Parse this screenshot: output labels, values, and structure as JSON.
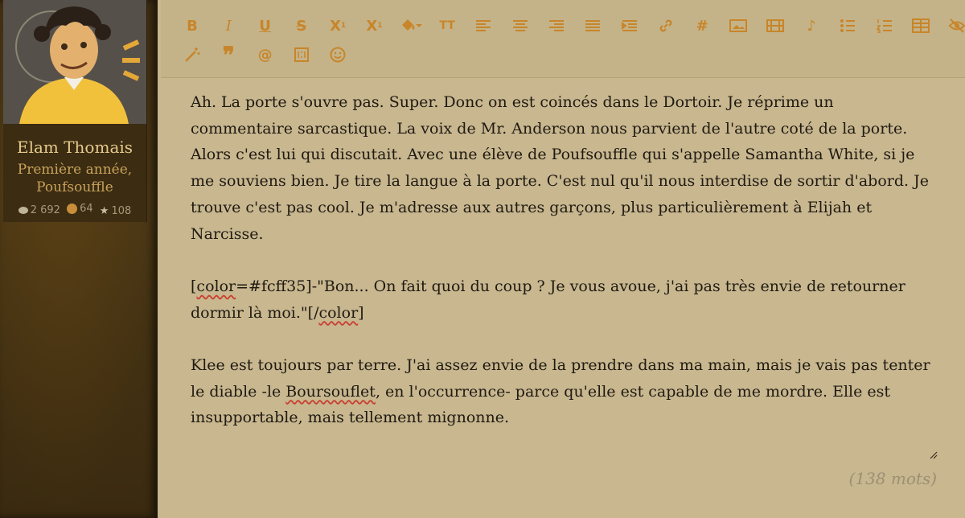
{
  "profile": {
    "name": "Elam Thomais",
    "rank_line1": "Première année,",
    "rank_line2": "Poufsouffle",
    "stats": {
      "messages": "2 692",
      "coins": "64",
      "stars": "108"
    }
  },
  "toolbar": {
    "row1": [
      "bold",
      "italic",
      "underline",
      "strikethrough",
      "subscript",
      "superscript",
      "text-color",
      "font-size",
      "align-left",
      "align-center",
      "align-right",
      "justify",
      "indent",
      "link",
      "hashtag",
      "image",
      "video",
      "music",
      "bullet-list",
      "numbered-list",
      "table",
      "hide"
    ],
    "row2": [
      "magic-wand",
      "quote",
      "mention",
      "spoiler",
      "emoji"
    ]
  },
  "content": {
    "p1": "Ah. La porte s'ouvre pas. Super. Donc on est coincés dans le Dortoir. Je réprime un commentaire sarcastique. La voix de Mr. Anderson nous parvient de l'autre coté de la porte. Alors c'est lui qui discutait. Avec une élève de Poufsouffle qui s'appelle Samantha White, si je me souviens bien. Je tire la langue à la porte. C'est nul qu'il nous interdise de sortir d'abord. Je trouve c'est pas cool. Je m'adresse aux autres garçons, plus particulièrement à Elijah et Narcisse.",
    "p2_open": "[",
    "p2_tag1": "color",
    "p2_mid": "=#fcff35]-\"Bon... On fait quoi du coup ? Je vous avoue, j'ai pas très envie de retourner dormir là moi.\"[/",
    "p2_tag2": "color",
    "p2_close": "]",
    "p3_a": "Klee est toujours par terre. J'ai assez envie de la prendre dans ma main, mais je vais pas tenter le diable -le ",
    "p3_word": "Boursouflet",
    "p3_b": ", en l'occurrence- parce qu'elle est capable de me mordre. Elle est insupportable, mais tellement mignonne."
  },
  "word_count": "(138 mots)",
  "colors": {
    "accent": "#c8852a",
    "background": "#c8b78f",
    "sidebar": "#3f2e13"
  }
}
